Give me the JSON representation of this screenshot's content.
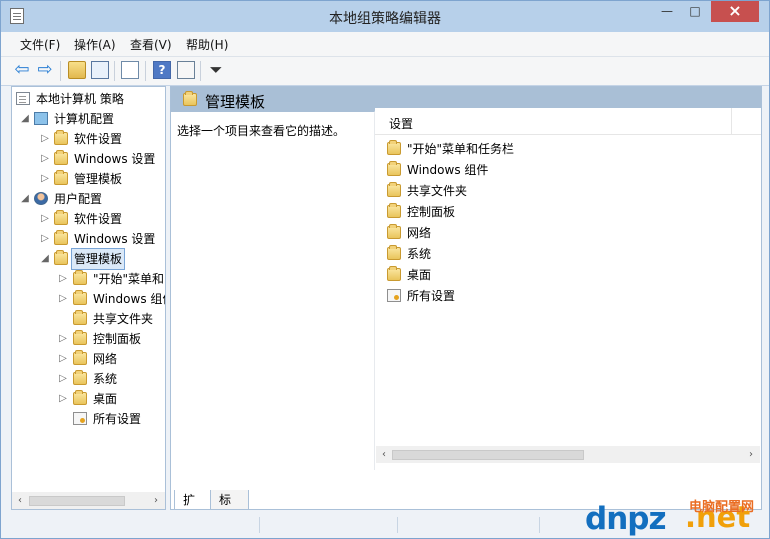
{
  "window": {
    "title": "本地组策略编辑器"
  },
  "menubar": {
    "items": [
      "文件(F)",
      "操作(A)",
      "查看(V)",
      "帮助(H)"
    ]
  },
  "toolbar": {
    "icons": [
      "back-icon",
      "forward-icon",
      "up-folder-icon",
      "show-hide-tree-icon",
      "export-list-icon",
      "help-icon",
      "properties-icon",
      "filter-icon"
    ]
  },
  "tree": {
    "root": "本地计算机 策略",
    "computer_config": "计算机配置",
    "computer_children": [
      "软件设置",
      "Windows 设置",
      "管理模板"
    ],
    "user_config": "用户配置",
    "user_children": [
      "软件设置",
      "Windows 设置",
      "管理模板"
    ],
    "admin_templates_children": [
      "\"开始\"菜单和",
      "Windows 组件",
      "共享文件夹",
      "控制面板",
      "网络",
      "系统",
      "桌面",
      "所有设置"
    ]
  },
  "right_pane": {
    "header": "管理模板",
    "description": "选择一个项目来查看它的描述。",
    "column_header": "设置",
    "items": [
      "\"开始\"菜单和任务栏",
      "Windows 组件",
      "共享文件夹",
      "控制面板",
      "网络",
      "系统",
      "桌面",
      "所有设置"
    ]
  },
  "tabs": {
    "active": "扩展",
    "inactive": "标准"
  },
  "watermark": {
    "logo": "dnpz",
    "site": ".net",
    "label": "电脑配置网"
  },
  "colors": {
    "title_bar": "#b7d0ea",
    "accent_blue": "#2a7fd4",
    "close_button": "#c7504f",
    "watermark_blue": "#136fbf",
    "watermark_orange": "#ea6d23"
  }
}
